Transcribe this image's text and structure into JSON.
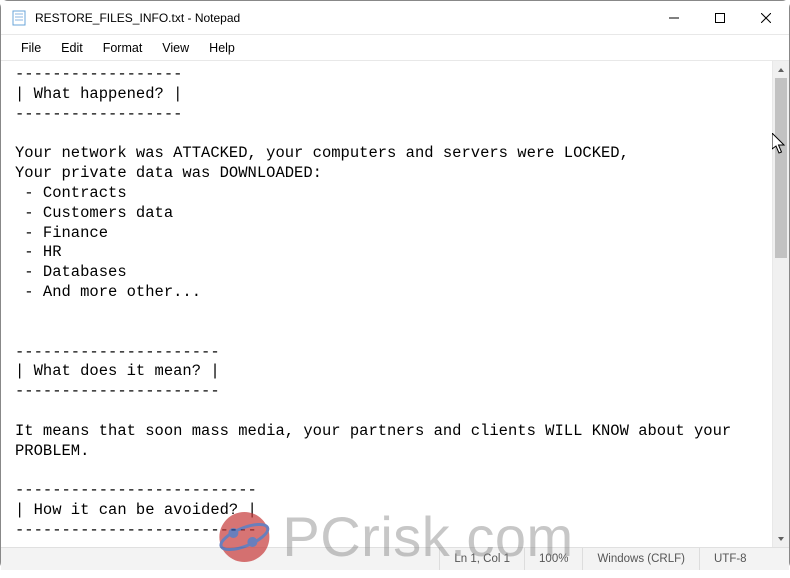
{
  "window": {
    "title": "RESTORE_FILES_INFO.txt - Notepad"
  },
  "menu": {
    "file": "File",
    "edit": "Edit",
    "format": "Format",
    "view": "View",
    "help": "Help"
  },
  "content": {
    "text": "------------------\n| What happened? |\n------------------\n\nYour network was ATTACKED, your computers and servers were LOCKED,\nYour private data was DOWNLOADED:\n - Contracts\n - Customers data\n - Finance\n - HR\n - Databases\n - And more other...\n\n\n----------------------\n| What does it mean? |\n----------------------\n\nIt means that soon mass media, your partners and clients WILL KNOW about your\nPROBLEM.\n\n--------------------------\n| How it can be avoided? |\n--------------------------"
  },
  "statusbar": {
    "position": "Ln 1, Col 1",
    "zoom": "100%",
    "lineending": "Windows (CRLF)",
    "encoding": "UTF-8"
  },
  "watermark": {
    "text": "PCrisk.com"
  }
}
